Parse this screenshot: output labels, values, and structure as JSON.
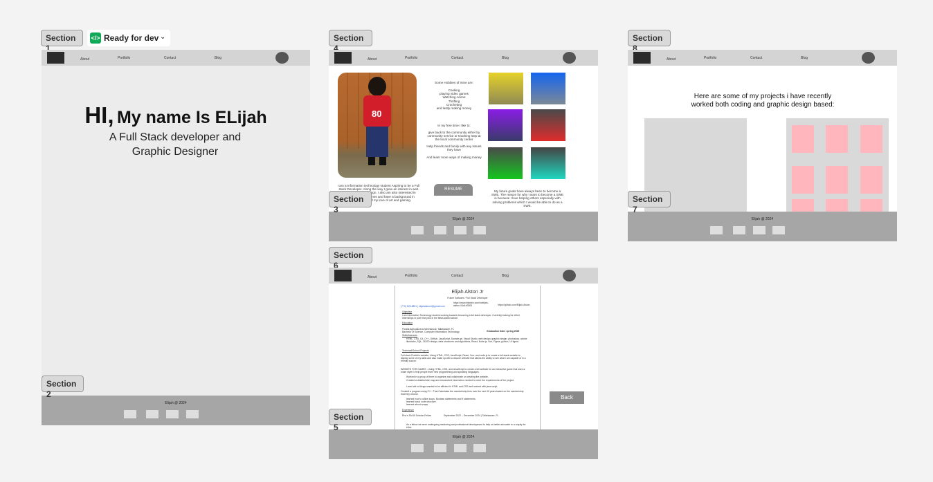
{
  "labels": {
    "s1": "Section 1",
    "s2": "Section 2",
    "s3": "Section 3",
    "s4": "Section 4",
    "s5": "Section 5",
    "s6": "Section 6",
    "s7": "Section 7",
    "s8": "Section 8"
  },
  "status": {
    "text": "Ready for dev",
    "icon": "code-icon",
    "color": "#0fa958"
  },
  "nav": {
    "about": "About",
    "portfolio": "Portfolio",
    "contact": "Contact",
    "blog": "Blog"
  },
  "footer": {
    "copyright": "Elijah @ 2024"
  },
  "home": {
    "hi": "HI,",
    "name": "My name Is ELijah",
    "subtitle": "A Full Stack developer and Graphic Designer"
  },
  "about": {
    "hobbies_title": "Some Hobbies of mine are:",
    "hobbies": "Cooking\nplaying video games\nWatching Anime\nThrifting\nCrocheting\nand lastly making money",
    "freetime_title": "In my free time I like to:",
    "freetime_1": "give back to the community either by community service or teaching step at the local community center",
    "freetime_2": "Help friends and family with any issues they have",
    "freetime_3": "And learn more ways of making money",
    "bio": "I am a Information technology student Aspiring to be a Full stack Developer. Along the way I grew an interest in web development and design. I also am also interested in developing video games and have a background in graphic design and my love of art and gaming.",
    "resume_button": "RESUME",
    "future": "My future goals have always been to become a SWE. The reason for why I want to become a SWE is because I love helping others especially with solving problems which I would be able to do as a SWE."
  },
  "gradients": [
    {
      "from": "#e6d229",
      "to": "#8f8a55"
    },
    {
      "from": "#1565f0",
      "to": "#7b8896"
    },
    {
      "from": "#8a1de6",
      "to": "#3a3a6a"
    },
    {
      "from": "#4a4a4a",
      "to": "#e02c2c"
    },
    {
      "from": "#4a4a4a",
      "to": "#14c61e"
    },
    {
      "from": "#444",
      "to": "#20d7bf"
    }
  ],
  "projects": {
    "intro": "Here are some of my projects i have recently worked both coding and graphic design based:"
  },
  "resume": {
    "name": "Elijah Alston Jr",
    "role": "Future Software / Full Stack Developer",
    "contact": "(770) 525-8891 | elijahalston4@gmail.com",
    "linkedin": "https://www.linkedin.com/in/elijah-alston-04a1b3300",
    "github": "https://github.com/Elijah-Alston",
    "objective_h": "Objective",
    "objective": "I am Information Technology student working towards becoming a full stack developer. Currently looking for either internships or part time jobs in the fields stated above.",
    "education_h": "Education",
    "school": "Florida Agricultural & Mechanical, Tallahassee, FL",
    "degree": "Bachelor of Science, Computer Information Technology",
    "grad": "Graduation Date: spring 2025",
    "skills_h": "Skills/Interests",
    "skills": "HTML, CSS, C#, C++, GitHub, JavaScript, Ssonde.ge, Visual Studio, web design, graphic design, photoshop, adobe illustrator, SQL, 3D/2D design, data structures and algorithms, React, Node.js, Vue, Figma, python, UI figma.",
    "projects_h": "Technical/School Projects",
    "proj1": "Full stack Portfolio website: Using HTML, CSS, JavaScript, React, Vue, and node.js to create a full stack website to display some of my skills and also make up with a resume website that allows the ability to see what I am capable of in a friendly source.",
    "proj2": "WEBSITE FOR GAMES - Using HTML, CSS, and JavaScript to create a full website for an interactive game that uses a maze style to help people learn new programming and speaking languages.",
    "b1": "Worked in a group of three to organize and collaborate on creating the website.",
    "b2": "Created a detailed site map and researched information needed to meet the requirements of the project.",
    "b3": "I was told to things needed to be efficient in HTML and CSS and worked with java script.",
    "proj3": "Created a program using C++: That Calculates the membership fees over the next 10 years based on the membership that they choose.",
    "b4": "learned how to utilize loops, Boolean statements and If statements.",
    "b5": "learned basic code structure.",
    "b6": "learned about arrays.",
    "experience_h": "Experience",
    "job": "Rho's 30x30 Scholar Fellow",
    "job_dates": "September 2022 – December 2024 | Tallahassee, FL",
    "job_b": "As a fellow we were undergoing mentoring and professional development to help us better advocate to or equity for educ."
  },
  "back_button": "Back"
}
